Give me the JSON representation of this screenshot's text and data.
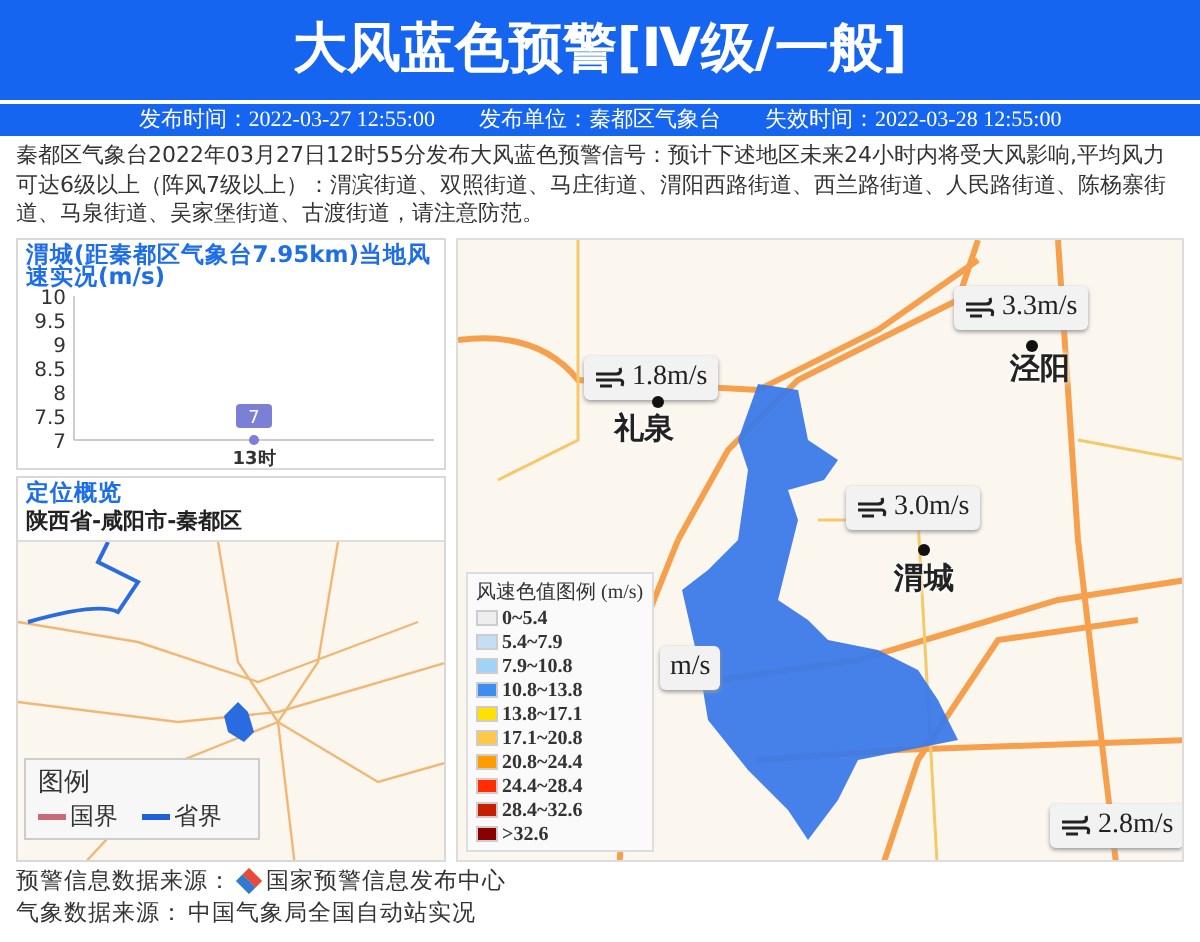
{
  "header": {
    "title": "大风蓝色预警[Ⅳ级/一般]"
  },
  "info_bar": [
    {
      "label": "发布时间：",
      "value": "2022-03-27 12:55:00"
    },
    {
      "label": "发布单位：",
      "value": "秦都区气象台"
    },
    {
      "label": "失效时间：",
      "value": "2022-03-28 12:55:00"
    }
  ],
  "message": "秦都区气象台2022年03月27日12时55分发布大风蓝色预警信号：预计下述地区未来24小时内将受大风影响,平均风力可达6级以上（阵风7级以上）：渭滨街道、双照街道、马庄街道、渭阳西路街道、西兰路街道、人民路街道、陈杨寨街道、马泉街道、吴家堡街道、古渡街道，请注意防范。",
  "wind_chart": {
    "title": "渭城(距秦都区气象台7.95km)当地风速实况(m/s)",
    "chart_data": {
      "type": "line",
      "categories": [
        "13时"
      ],
      "ylim": [
        7,
        10
      ],
      "yticks": [
        7,
        7.5,
        8,
        8.5,
        9,
        9.5,
        10
      ],
      "data_labels": true,
      "series": [
        {
          "color": "#7b7fd6",
          "marker": true,
          "values": [
            7
          ]
        }
      ]
    }
  },
  "location": {
    "title": "定位概览",
    "path": "陕西省-咸阳市-秦都区",
    "legend": {
      "title": "图例",
      "items": [
        {
          "label": "国界",
          "color": "#c96a78"
        },
        {
          "label": "省界",
          "color": "#1f5fd8"
        }
      ]
    }
  },
  "wind_map": {
    "wind_labels": [
      {
        "text": "1.8m/s"
      },
      {
        "text": "3.3m/s"
      },
      {
        "text": "3.0m/s"
      },
      {
        "text": "m/s"
      },
      {
        "text": "2.8m/s"
      }
    ],
    "places": [
      {
        "name": "礼泉"
      },
      {
        "name": "泾阳"
      },
      {
        "name": "渭城"
      }
    ],
    "legend": {
      "title": "风速色值图例 (m/s)",
      "items": [
        {
          "label": "0~5.4",
          "color": "#eeeeee"
        },
        {
          "label": "5.4~7.9",
          "color": "#c6def5"
        },
        {
          "label": "7.9~10.8",
          "color": "#9fd3f7"
        },
        {
          "label": "10.8~13.8",
          "color": "#3d8ef0"
        },
        {
          "label": "13.8~17.1",
          "color": "#ffe100"
        },
        {
          "label": "17.1~20.8",
          "color": "#ffc947"
        },
        {
          "label": "20.8~24.4",
          "color": "#ff9c00"
        },
        {
          "label": "24.4~28.4",
          "color": "#ff2d00"
        },
        {
          "label": "28.4~32.6",
          "color": "#c81e00"
        },
        {
          "label": ">32.6",
          "color": "#8b0000"
        }
      ]
    }
  },
  "footer": [
    {
      "label": "预警信息数据来源：",
      "source": "国家预警信息发布中心"
    },
    {
      "label": "气象数据来源：",
      "source": "中国气象局全国自动站实况"
    }
  ]
}
